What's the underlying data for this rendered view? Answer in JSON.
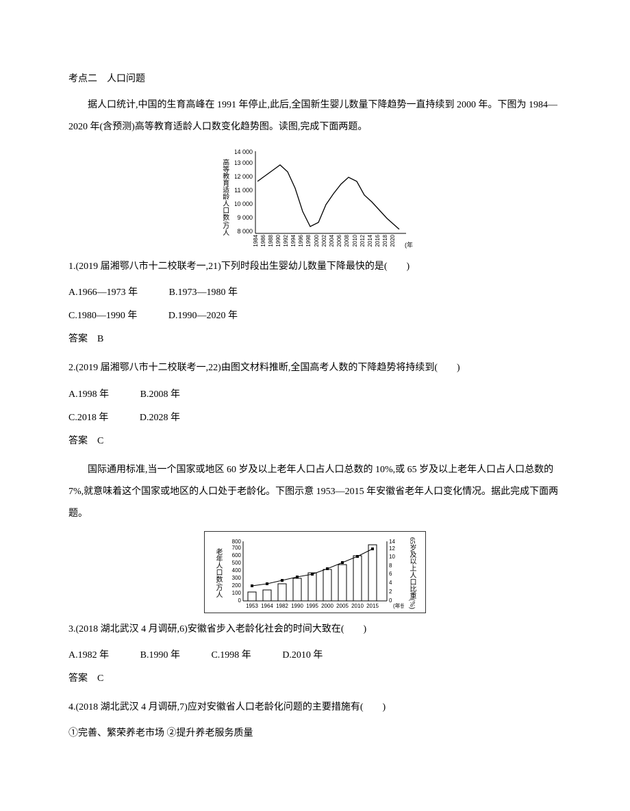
{
  "heading": "考点二　人口问题",
  "passage1": "据人口统计,中国的生育高峰在 1991 年停止,此后,全国新生婴儿数量下降趋势一直持续到 2000 年。下图为 1984—2020 年(含预测)高等教育适龄人口数变化趋势图。读图,完成下面两题。",
  "q1": {
    "stem": "1.(2019 届湘鄂八市十二校联考一,21)下列时段出生婴幼儿数量下降最快的是(　　)",
    "a": "A.1966—1973 年",
    "b": "B.1973—1980 年",
    "c": "C.1980—1990 年",
    "d": "D.1990—2020 年",
    "ans": "答案　B"
  },
  "q2": {
    "stem": "2.(2019 届湘鄂八市十二校联考一,22)由图文材料推断,全国高考人数的下降趋势将持续到(　　)",
    "a": "A.1998 年",
    "b": "B.2008 年",
    "c": "C.2018 年",
    "d": "D.2028 年",
    "ans": "答案　C"
  },
  "passage2": "国际通用标准,当一个国家或地区 60 岁及以上老年人口占人口总数的 10%,或 65 岁及以上老年人口占人口总数的 7%,就意味着这个国家或地区的人口处于老龄化。下图示意 1953—2015 年安徽省老年人口变化情况。据此完成下面两题。",
  "q3": {
    "stem": "3.(2018 湖北武汉 4 月调研,6)安徽省步入老龄化社会的时间大致在(　　)",
    "a": "A.1982 年",
    "b": "B.1990 年",
    "c": "C.1998 年",
    "d": "D.2010 年",
    "ans": "答案　C"
  },
  "q4": {
    "stem": "4.(2018 湖北武汉 4 月调研,7)应对安徽省人口老龄化问题的主要措施有(　　)",
    "opt1": "①完善、繁荣养老市场 ②提升养老服务质量"
  },
  "chart1": {
    "ylabel": "高等教育适龄人口数/万人",
    "xlabel": "(年)",
    "yticks": [
      8000,
      9000,
      10000,
      11000,
      12000,
      13000,
      14000
    ]
  },
  "chart2": {
    "ylabel_left": "老年人口数/万人",
    "ylabel_right": "65岁及以上人口比重(%)",
    "xlabel": "(年份)",
    "yticks_left": [
      0,
      100,
      200,
      300,
      400,
      500,
      600,
      700,
      800
    ],
    "yticks_right": [
      0,
      2,
      4,
      6,
      8,
      10,
      12,
      14
    ]
  },
  "chart_data": [
    {
      "type": "line",
      "title": "1984—2020 高等教育适龄人口数变化趋势",
      "xlabel": "年",
      "ylabel": "高等教育适龄人口数/万人",
      "ylim": [
        8000,
        14000
      ],
      "x": [
        1984,
        1986,
        1988,
        1990,
        1992,
        1994,
        1996,
        1998,
        2000,
        2002,
        2004,
        2006,
        2008,
        2010,
        2012,
        2014,
        2016,
        2018,
        2020
      ],
      "values": [
        11700,
        12100,
        12500,
        12900,
        12400,
        11200,
        9500,
        8400,
        8700,
        10000,
        10800,
        11500,
        12000,
        11700,
        10700,
        10200,
        9600,
        9000,
        8200
      ]
    },
    {
      "type": "bar",
      "title": "1953—2015 安徽省老年人口变化",
      "xlabel": "年份",
      "ylabel_left": "老年人口数/万人",
      "ylabel_right": "65岁及以上人口比重(%)",
      "ylim_left": [
        0,
        800
      ],
      "ylim_right": [
        0,
        14
      ],
      "categories": [
        1953,
        1964,
        1982,
        1990,
        1995,
        2000,
        2005,
        2010,
        2015
      ],
      "series": [
        {
          "name": "老年人口数(万人)",
          "values": [
            120,
            150,
            230,
            300,
            370,
            420,
            480,
            600,
            750
          ]
        },
        {
          "name": "65岁及以上人口比重(%)",
          "values": [
            3.5,
            4.0,
            4.8,
            5.5,
            6.2,
            7.5,
            8.8,
            10.2,
            12.0
          ]
        }
      ]
    }
  ]
}
